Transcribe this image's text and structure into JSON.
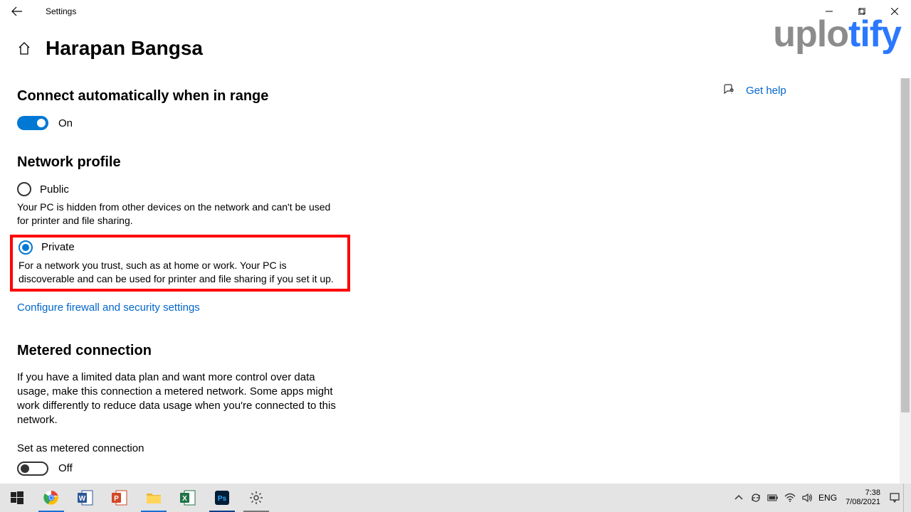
{
  "window": {
    "title": "Settings"
  },
  "page": {
    "network_name": "Harapan Bangsa"
  },
  "auto_connect": {
    "heading": "Connect automatically when in range",
    "state_label": "On"
  },
  "network_profile": {
    "heading": "Network profile",
    "public": {
      "label": "Public",
      "desc": "Your PC is hidden from other devices on the network and can't be used for printer and file sharing."
    },
    "private": {
      "label": "Private",
      "desc": "For a network you trust, such as at home or work. Your PC is discoverable and can be used for printer and file sharing if you set it up."
    },
    "firewall_link": "Configure firewall and security settings"
  },
  "metered": {
    "heading": "Metered connection",
    "desc": "If you have a limited data plan and want more control over data usage, make this connection a metered network. Some apps might work differently to reduce data usage when you're connected to this network.",
    "toggle_label": "Set as metered connection",
    "state_label": "Off"
  },
  "help": {
    "label": "Get help"
  },
  "watermark": {
    "part1": "uplo",
    "part2": "tify"
  },
  "taskbar": {
    "lang": "ENG",
    "time": "7:38",
    "date": "7/08/2021"
  }
}
